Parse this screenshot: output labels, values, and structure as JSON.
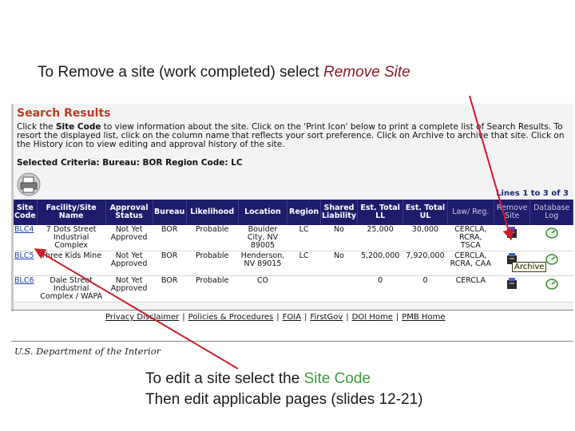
{
  "caption_top": {
    "text": "To Remove a site (work completed) select ",
    "highlight": "Remove Site"
  },
  "caption_bottom": {
    "line1_text": "To edit a site select the ",
    "line1_highlight": "Site Code",
    "line2": "Then edit applicable pages (slides 12-21)"
  },
  "search": {
    "title": "Search Results",
    "instr_1": "Click the ",
    "instr_bold": "Site Code",
    "instr_2": " to view information about the site. Click on the 'Print Icon' below to print a complete list of Search Results. To resort the displayed list, click on the column name that reflects your sort preference. Click on Archive to archive that site. Click on the History icon to view editing and approval history of the site.",
    "criteria": "Selected Criteria: Bureau: BOR Region Code: LC",
    "lines": "Lines 1 to 3 of 3",
    "archive_tooltip": "Archive"
  },
  "table": {
    "headers": [
      "Site Code",
      "Facility/Site Name",
      "Approval Status",
      "Bureau",
      "Likelihood",
      "Location",
      "Region",
      "Shared Liability",
      "Est. Total LL",
      "Est. Total UL",
      "Law/ Reg.",
      "Remove Site",
      "Database Log"
    ],
    "rows": [
      [
        "BLC4",
        "7 Dots Street Industrial Complex",
        "Not Yet Approved",
        "BOR",
        "Probable",
        "Boulder City, NV 89005",
        "LC",
        "No",
        "25,000",
        "30,000",
        "CERCLA, RCRA, TSCA"
      ],
      [
        "BLC5",
        "Three Kids Mine",
        "Not Yet Approved",
        "BOR",
        "Probable",
        "Henderson, NV 89015",
        "LC",
        "No",
        "5,200,000",
        "7,920,000",
        "CERCLA, RCRA, CAA"
      ],
      [
        "BLC6",
        "Dale Street Industrial Complex / WAPA",
        "Not Yet Approved",
        "BOR",
        "Probable",
        "CO",
        "",
        "",
        "0",
        "0",
        "CERCLA"
      ]
    ]
  },
  "footer": {
    "links": [
      "Privacy Disclaimer",
      "Policies & Procedures",
      "FOIA",
      "FirstGov",
      "DOI Home",
      "PMB Home"
    ],
    "sep": "|",
    "dept": "U.S. Department of the Interior"
  }
}
